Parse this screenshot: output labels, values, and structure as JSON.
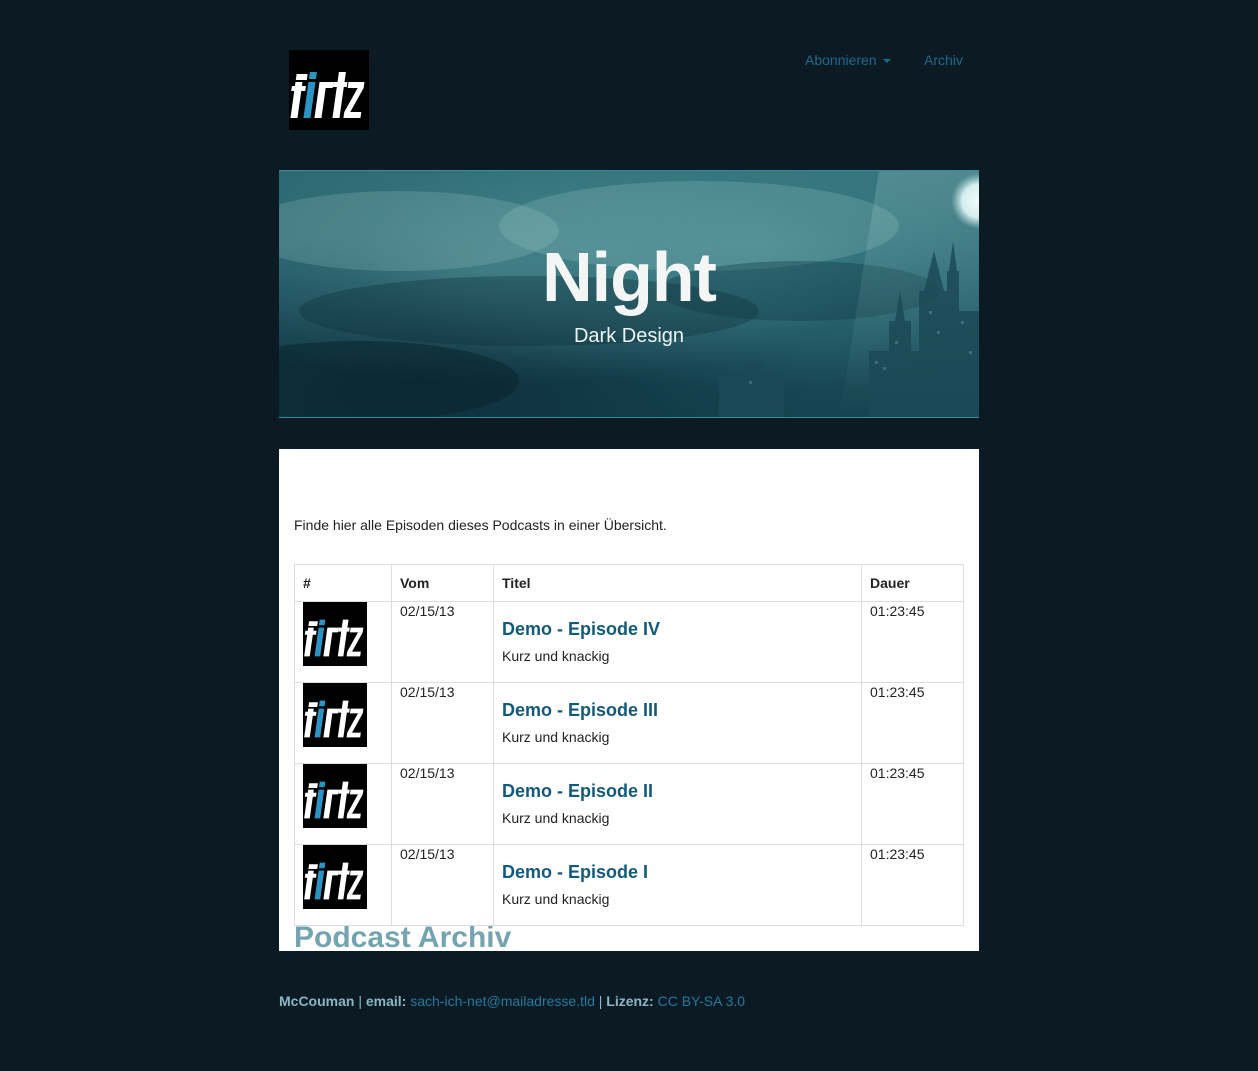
{
  "brand": {
    "logo_text": "fiirtz",
    "logo_alt": "firtz logo"
  },
  "nav": {
    "subscribe_label": "Abonnieren",
    "archive_label": "Archiv"
  },
  "hero": {
    "title": "Night",
    "subtitle": "Dark Design"
  },
  "main": {
    "heading": "Podcast Archiv",
    "intro": "Finde hier alle Episoden dieses Podcasts in einer Übersicht.",
    "table": {
      "headers": [
        "#",
        "Vom",
        "Titel",
        "Dauer"
      ],
      "rows": [
        {
          "date": "02/15/13",
          "title": "Demo - Episode IV",
          "subtitle": "Kurz und knackig",
          "duration": "01:23:45"
        },
        {
          "date": "02/15/13",
          "title": "Demo - Episode III",
          "subtitle": "Kurz und knackig",
          "duration": "01:23:45"
        },
        {
          "date": "02/15/13",
          "title": "Demo - Episode II",
          "subtitle": "Kurz und knackig",
          "duration": "01:23:45"
        },
        {
          "date": "02/15/13",
          "title": "Demo - Episode I",
          "subtitle": "Kurz und knackig",
          "duration": "01:23:45"
        }
      ]
    }
  },
  "footer": {
    "author": "McCouman",
    "sep1": " | ",
    "email_label": "email:",
    "email": "sach-ich-net@mailadresse.tld",
    "sep2": " | ",
    "license_label": "Lizenz:",
    "license": "CC BY-SA 3.0"
  },
  "colors": {
    "background": "#0c1a23",
    "link": "#1c6b8e",
    "heading": "#75a4b1",
    "episode_link": "#125a7a",
    "footer_text": "#8ab6c6"
  }
}
